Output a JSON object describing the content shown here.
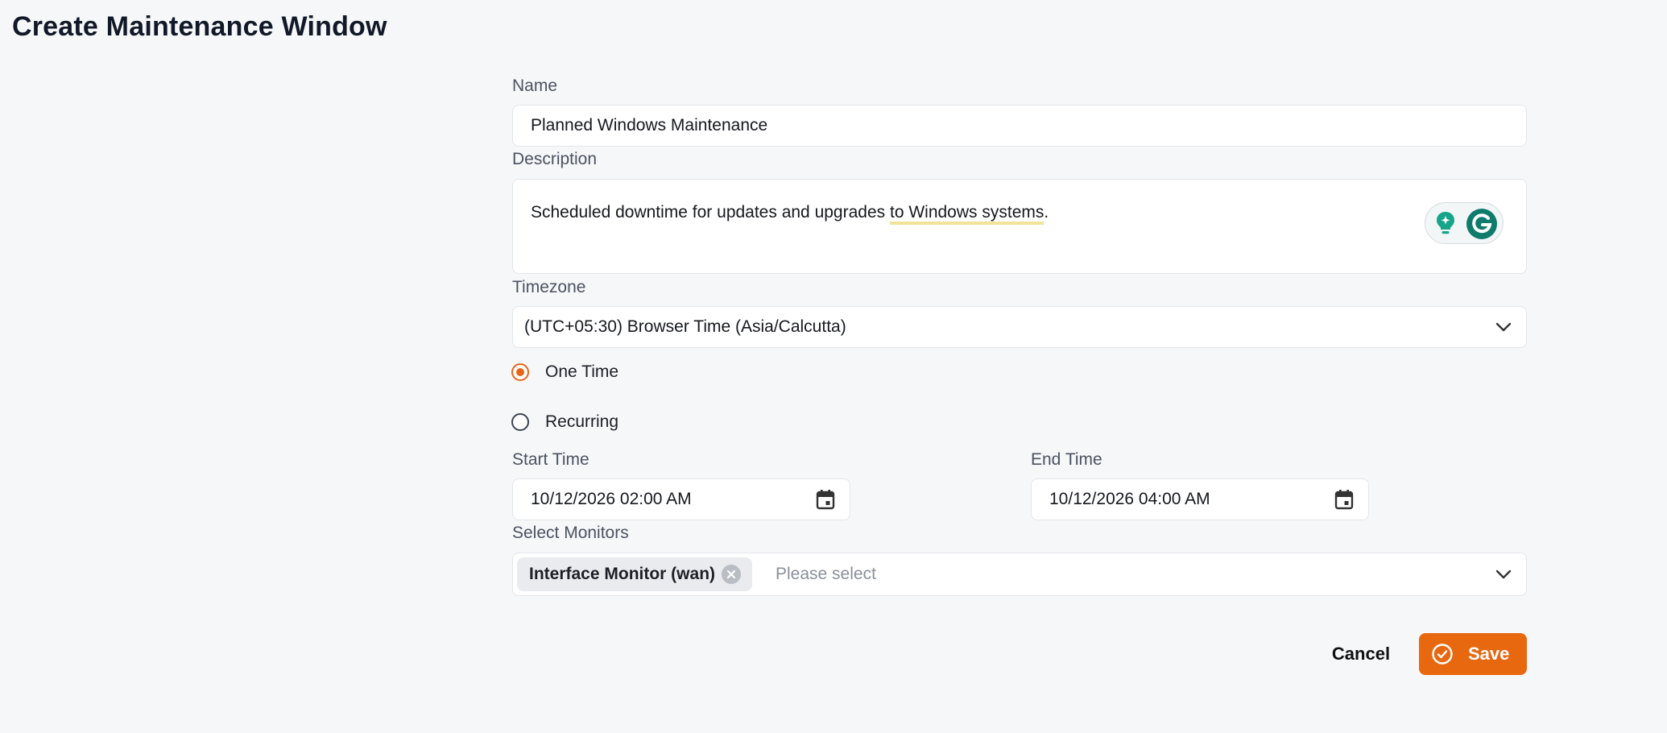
{
  "page": {
    "title": "Create Maintenance Window"
  },
  "form": {
    "name": {
      "label": "Name",
      "value": "Planned Windows Maintenance"
    },
    "description": {
      "label": "Description",
      "value_before": "Scheduled downtime for updates and upgrades ",
      "value_highlight": "to Windows systems",
      "value_after": "."
    },
    "timezone": {
      "label": "Timezone",
      "value": "(UTC+05:30) Browser Time (Asia/Calcutta)"
    },
    "schedule_type": {
      "options": [
        {
          "label": "One Time",
          "selected": true
        },
        {
          "label": "Recurring",
          "selected": false
        }
      ]
    },
    "start_time": {
      "label": "Start Time",
      "value": "10/12/2026 02:00 AM"
    },
    "end_time": {
      "label": "End Time",
      "value": "10/12/2026 04:00 AM"
    },
    "monitors": {
      "label": "Select Monitors",
      "selected": [
        "Interface Monitor (wan)"
      ],
      "placeholder": "Please select"
    }
  },
  "actions": {
    "cancel_label": "Cancel",
    "save_label": "Save"
  },
  "colors": {
    "accent": "#e8680f",
    "background": "#f6f7f9",
    "grammarly": "#15a58a"
  },
  "icons": [
    "chevron-down-icon",
    "calendar-icon",
    "close-icon",
    "check-circle-icon",
    "grammarly-icon",
    "lightbulb-icon"
  ]
}
